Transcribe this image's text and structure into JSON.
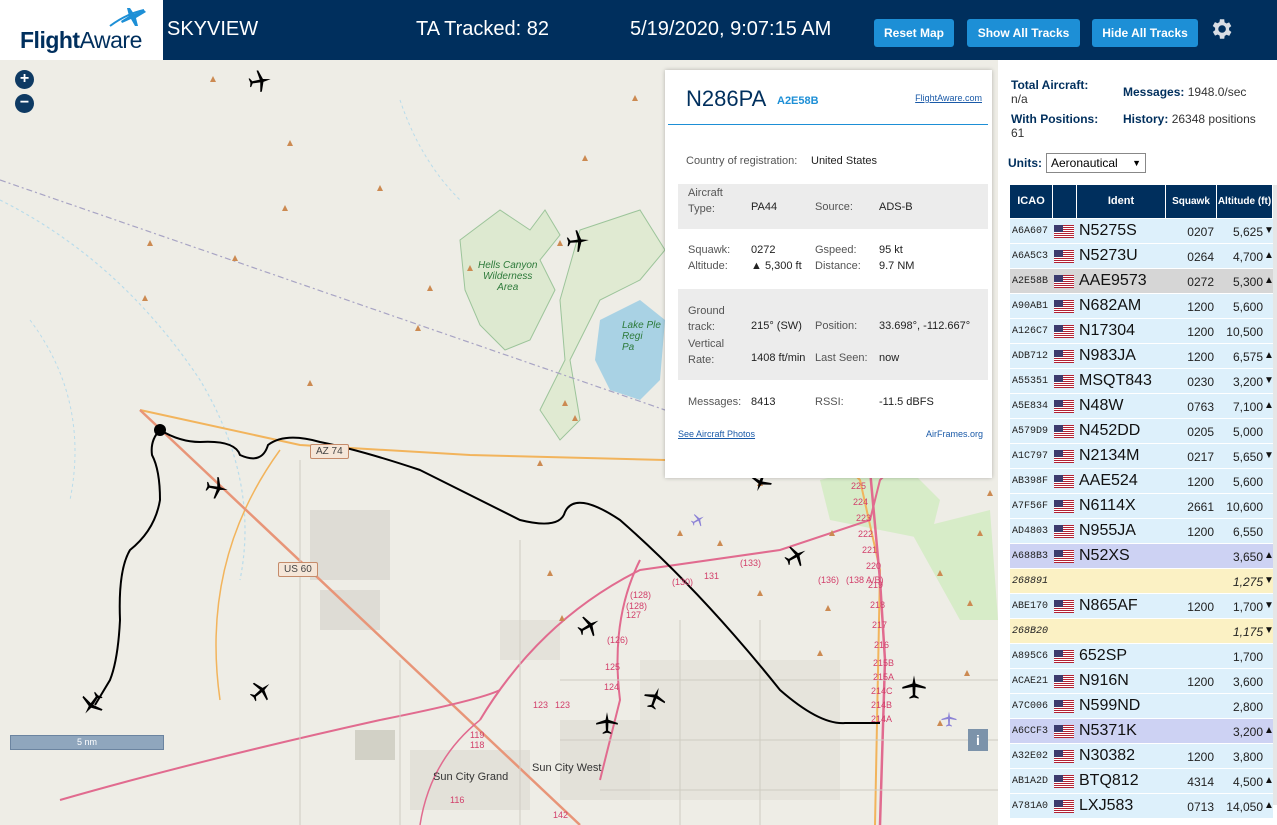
{
  "header": {
    "logo_flight": "Flight",
    "logo_aware": "Aware",
    "app_title": "SKYVIEW",
    "ta_tracked": "TA Tracked: 82",
    "datetime": "5/19/2020, 9:07:15 AM",
    "reset_map": "Reset Map",
    "show_all_tracks": "Show All Tracks",
    "hide_all_tracks": "Hide All Tracks"
  },
  "map": {
    "zoom_in": "+",
    "zoom_out": "−",
    "scale_label": "5 nm",
    "info_label": "i",
    "labels": {
      "hells_canyon": "Hells Canyon\nWilderness\nArea",
      "lake_pleasant": "Lake Ple\nRegi\nPa",
      "az74": "AZ 74",
      "us60": "US 60",
      "sun_city_grand": "Sun City Grand",
      "sun_city_west": "Sun City West"
    },
    "road_numbers": [
      "225",
      "224",
      "223",
      "222",
      "221",
      "220",
      "219",
      "218",
      "217",
      "216",
      "215B",
      "215A",
      "214C",
      "214B",
      "214A",
      "131",
      "(130)",
      "(133)",
      "(136)",
      "(138 A/B)",
      "(128)",
      "(128)",
      "127",
      "(126)",
      "125",
      "124",
      "123",
      "123",
      "119",
      "118",
      "116",
      "142"
    ]
  },
  "popup": {
    "registration": "N286PA",
    "hex": "A2E58B",
    "flightaware_link": "FlightAware.com",
    "country_label": "Country of registration:",
    "country_value": "United States",
    "aircraft_type_label": "Aircraft Type:",
    "aircraft_type_value": "PA44",
    "source_label": "Source:",
    "source_value": "ADS-B",
    "squawk_label": "Squawk:",
    "squawk_value": "0272",
    "gspeed_label": "Gspeed:",
    "gspeed_value": "95 kt",
    "altitude_label": "Altitude:",
    "altitude_value": "▲ 5,300 ft",
    "distance_label": "Distance:",
    "distance_value": "9.7 NM",
    "ground_track_label": "Ground track:",
    "ground_track_value": "215° (SW)",
    "position_label": "Position:",
    "position_value": "33.698°, -112.667°",
    "vertical_rate_label": "Vertical Rate:",
    "vertical_rate_value": "1408 ft/min",
    "last_seen_label": "Last Seen:",
    "last_seen_value": "now",
    "messages_label": "Messages:",
    "messages_value": "8413",
    "rssi_label": "RSSI:",
    "rssi_value": "-11.5 dBFS",
    "photos_link": "See Aircraft Photos",
    "airframes_link": "AirFrames.org"
  },
  "panel": {
    "total_aircraft_label": "Total Aircraft:",
    "total_aircraft_value": "n/a",
    "messages_label": "Messages:",
    "messages_value": "1948.0/sec",
    "with_positions_label": "With Positions:",
    "with_positions_value": "61",
    "history_label": "History:",
    "history_value": "26348 positions",
    "units_label": "Units:",
    "units_value": "Aeronautical",
    "columns": [
      "ICAO",
      "",
      "Ident",
      "Squawk",
      "Altitude (ft)"
    ],
    "rows": [
      {
        "icao": "A6A607",
        "ident": "N5275S",
        "squawk": "0207",
        "alt": "5,625",
        "arrow": "▼",
        "flag": true,
        "bg": "#ddf0fb"
      },
      {
        "icao": "A6A5C3",
        "ident": "N5273U",
        "squawk": "0264",
        "alt": "4,700",
        "arrow": "▲",
        "flag": true,
        "bg": "#ddf0fb"
      },
      {
        "icao": "A2E58B",
        "ident": "AAE9573",
        "squawk": "0272",
        "alt": "5,300",
        "arrow": "▲",
        "flag": true,
        "bg": "#d6d6d6"
      },
      {
        "icao": "A90AB1",
        "ident": "N682AM",
        "squawk": "1200",
        "alt": "5,600",
        "arrow": "",
        "flag": true,
        "bg": "#ddf0fb"
      },
      {
        "icao": "A126C7",
        "ident": "N17304",
        "squawk": "1200",
        "alt": "10,500",
        "arrow": "",
        "flag": true,
        "bg": "#ddf0fb"
      },
      {
        "icao": "ADB712",
        "ident": "N983JA",
        "squawk": "1200",
        "alt": "6,575",
        "arrow": "▲",
        "flag": true,
        "bg": "#ddf0fb"
      },
      {
        "icao": "A55351",
        "ident": "MSQT843",
        "squawk": "0230",
        "alt": "3,200",
        "arrow": "▼",
        "flag": true,
        "bg": "#ddf0fb"
      },
      {
        "icao": "A5E834",
        "ident": "N48W",
        "squawk": "0763",
        "alt": "7,100",
        "arrow": "▲",
        "flag": true,
        "bg": "#ddf0fb"
      },
      {
        "icao": "A579D9",
        "ident": "N452DD",
        "squawk": "0205",
        "alt": "5,000",
        "arrow": "",
        "flag": true,
        "bg": "#ddf0fb"
      },
      {
        "icao": "A1C797",
        "ident": "N2134M",
        "squawk": "0217",
        "alt": "5,650",
        "arrow": "▼",
        "flag": true,
        "bg": "#ddf0fb"
      },
      {
        "icao": "AB398F",
        "ident": "AAE524",
        "squawk": "1200",
        "alt": "5,600",
        "arrow": "",
        "flag": true,
        "bg": "#ddf0fb"
      },
      {
        "icao": "A7F56F",
        "ident": "N6114X",
        "squawk": "2661",
        "alt": "10,600",
        "arrow": "",
        "flag": true,
        "bg": "#ddf0fb"
      },
      {
        "icao": "AD4803",
        "ident": "N955JA",
        "squawk": "1200",
        "alt": "6,550",
        "arrow": "",
        "flag": true,
        "bg": "#ddf0fb"
      },
      {
        "icao": "A688B3",
        "ident": "N52XS",
        "squawk": "",
        "alt": "3,650",
        "arrow": "▲",
        "flag": true,
        "bg": "#cdd2f3"
      },
      {
        "icao": "268891",
        "ident": "",
        "squawk": "",
        "alt": "1,275",
        "arrow": "▼",
        "flag": false,
        "bg": "#fbf1c4",
        "mlat": true
      },
      {
        "icao": "ABE170",
        "ident": "N865AF",
        "squawk": "1200",
        "alt": "1,700",
        "arrow": "▼",
        "flag": true,
        "bg": "#ddf0fb"
      },
      {
        "icao": "268B20",
        "ident": "",
        "squawk": "",
        "alt": "1,175",
        "arrow": "▼",
        "flag": false,
        "bg": "#fbf1c4",
        "mlat": true
      },
      {
        "icao": "A895C6",
        "ident": "652SP",
        "squawk": "",
        "alt": "1,700",
        "arrow": "",
        "flag": true,
        "bg": "#ddf0fb"
      },
      {
        "icao": "ACAE21",
        "ident": "N916N",
        "squawk": "1200",
        "alt": "3,600",
        "arrow": "",
        "flag": true,
        "bg": "#ddf0fb"
      },
      {
        "icao": "A7C006",
        "ident": "N599ND",
        "squawk": "",
        "alt": "2,800",
        "arrow": "",
        "flag": true,
        "bg": "#ddf0fb"
      },
      {
        "icao": "A6CCF3",
        "ident": "N5371K",
        "squawk": "",
        "alt": "3,200",
        "arrow": "▲",
        "flag": true,
        "bg": "#cdd2f3"
      },
      {
        "icao": "A32E02",
        "ident": "N30382",
        "squawk": "1200",
        "alt": "3,800",
        "arrow": "",
        "flag": true,
        "bg": "#ddf0fb"
      },
      {
        "icao": "AB1A2D",
        "ident": "BTQ812",
        "squawk": "4314",
        "alt": "4,500",
        "arrow": "▲",
        "flag": true,
        "bg": "#ddf0fb"
      },
      {
        "icao": "A781A0",
        "ident": "LXJ583",
        "squawk": "0713",
        "alt": "14,050",
        "arrow": "▲",
        "flag": true,
        "bg": "#ddf0fb"
      }
    ]
  },
  "colors": {
    "header_bg": "#002f5d",
    "button_bg": "#1d8fd6",
    "accent": "#1d8fd6"
  }
}
